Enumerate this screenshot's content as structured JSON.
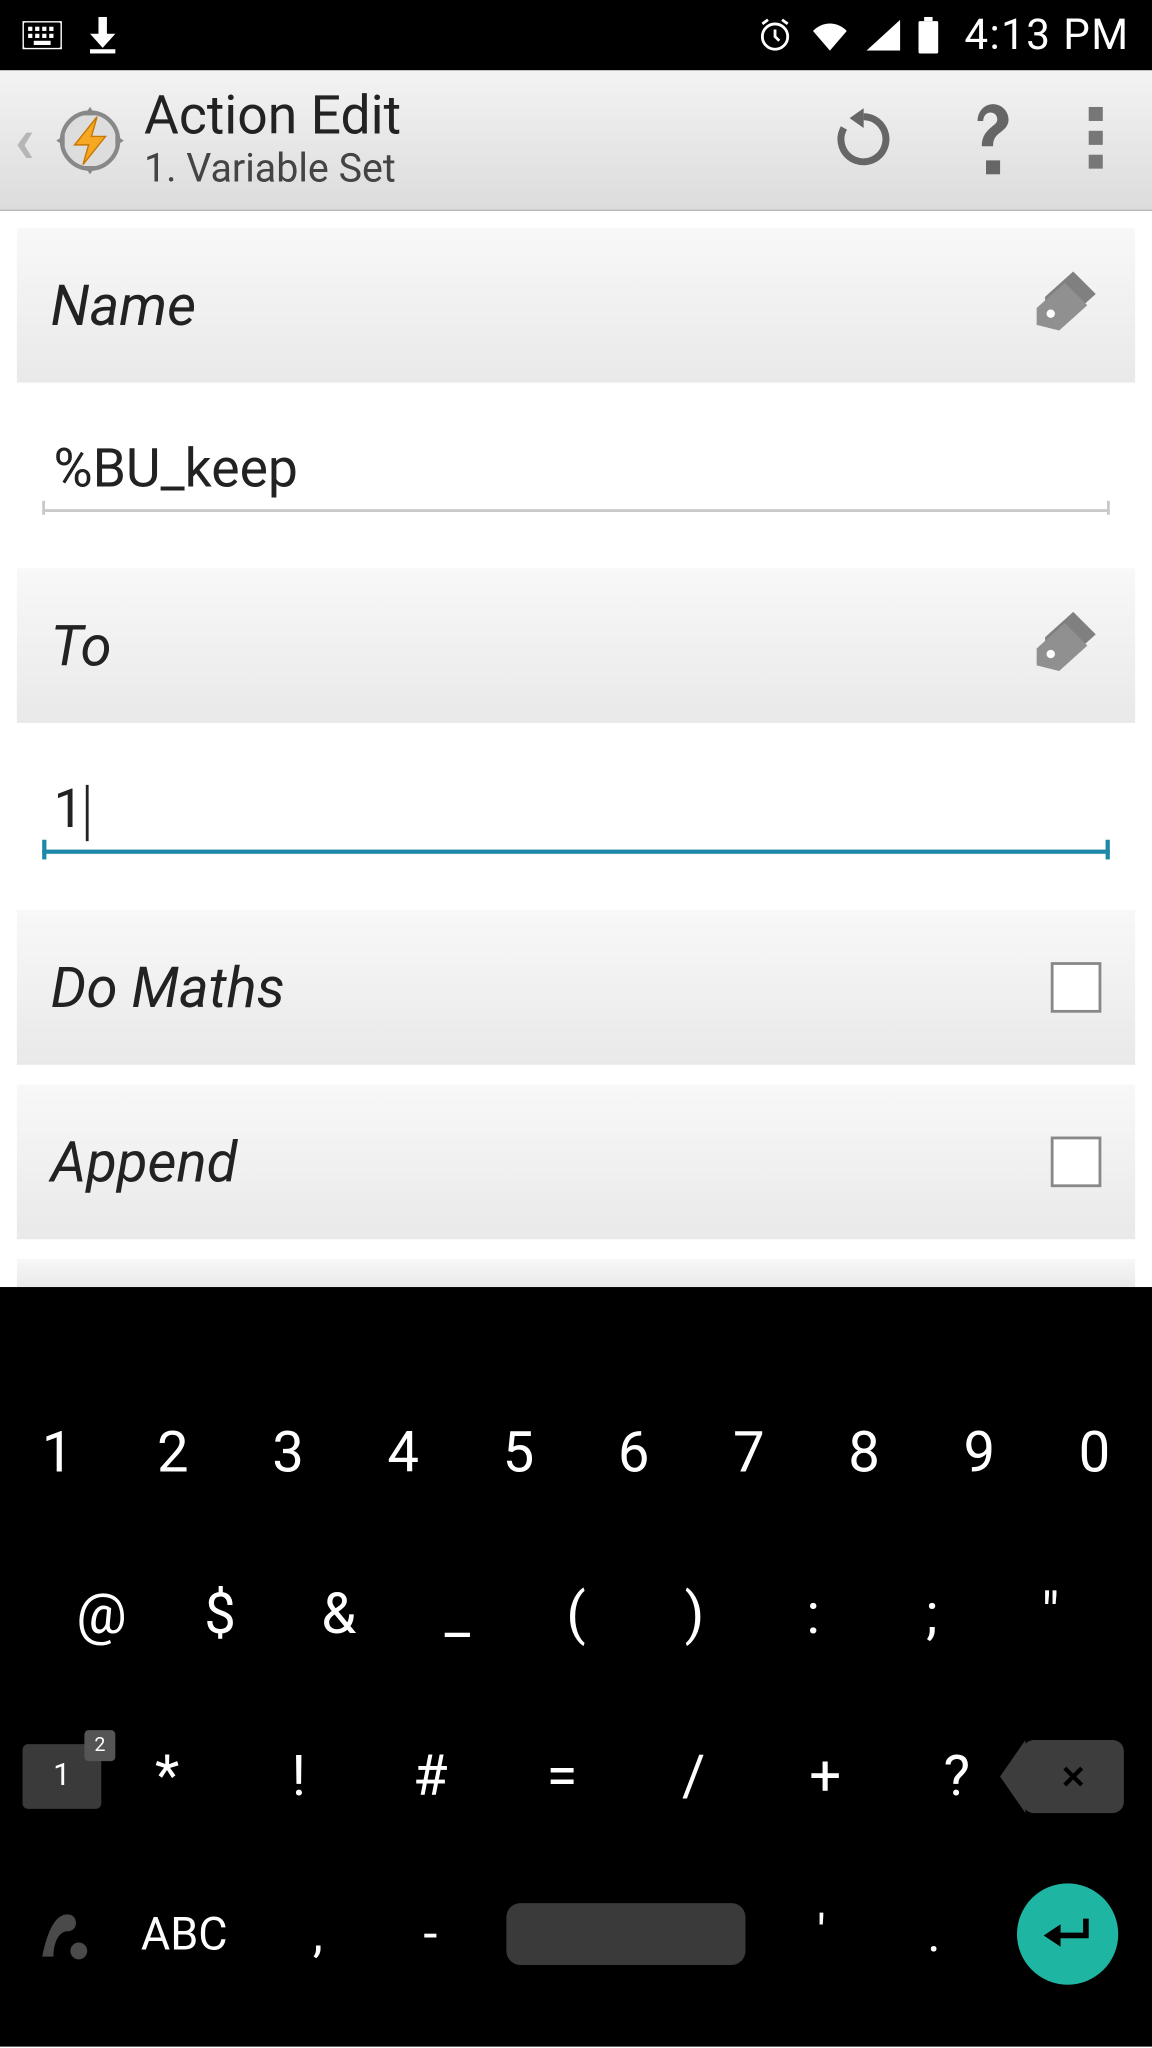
{
  "status": {
    "time": "4:13 PM"
  },
  "header": {
    "title": "Action Edit",
    "subtitle": "1. Variable Set"
  },
  "fields": {
    "name_label": "Name",
    "name_value": "%BU_keep",
    "to_label": "To",
    "to_value": "1",
    "do_maths_label": "Do Maths",
    "append_label": "Append"
  },
  "keyboard": {
    "row1": [
      "1",
      "2",
      "3",
      "4",
      "5",
      "6",
      "7",
      "8",
      "9",
      "0"
    ],
    "row2": [
      "@",
      "$",
      "&",
      "_",
      "(",
      ")",
      ":",
      ";",
      "\""
    ],
    "row3_numlock": "1",
    "row3_numlock_sup": "2",
    "row3": [
      "*",
      "!",
      "#",
      "=",
      "/",
      "+",
      "?"
    ],
    "row4_abc": "ABC",
    "row4_comma": ",",
    "row4_dash": "-",
    "row4_apos": "'",
    "row4_dot": "."
  }
}
